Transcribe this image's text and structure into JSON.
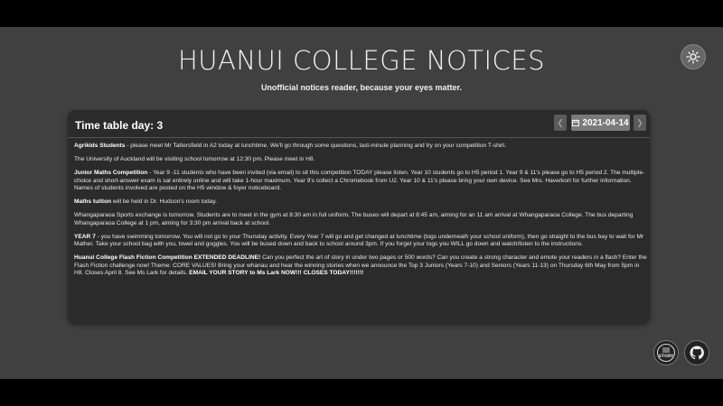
{
  "header": {
    "title": "HUANUI COLLEGE NOTICES",
    "subtitle": "Unofficial notices reader, because your eyes matter."
  },
  "toolbar": {
    "theme_icon": "sun-icon"
  },
  "card": {
    "day_label": "Time table day: 3",
    "date": "2021-04-14",
    "prev_icon": "chevron-left-icon",
    "next_icon": "chevron-right-icon",
    "calendar_icon": "calendar-icon"
  },
  "notices": [
    {
      "title": "Agrikids Students",
      "sep": " - ",
      "body": "please meet Mr Tattersfield in A2 today at lunchtime. We'll go through some questions, last-minute planning and try on your competition T-shirt."
    },
    {
      "title": "",
      "sep": "",
      "body": "The University of Auckland will be visiting school tomorrow at 12:30 pm. Please meet in H8."
    },
    {
      "title": "Junior Maths Competition",
      "sep": " - ",
      "body": "Year 9 -11 students who have been invited (via email) to sit this competition TODAY please listen. Year 10 students go to H5 period 1. Year 9 & 11's please go to H5  period 2.  The multiple-choice and short-answer exam is sat entirely online and will take 1-hour maximum. Year 9's collect a Chromebook from U2. Year 10 & 11's please bring your own device. See Mrs. Haverkort for further information. Names of students involved are posted on the H5 window & foyer noticeboard."
    },
    {
      "title": "Maths tuition",
      "sep": " ",
      "body": "will be held in Dr. Hudson's room today."
    },
    {
      "title": "",
      "sep": "",
      "body": "Whangaparaoa Sports exchange is tomorrow. Students are to meet in the gym at 8:30 am in full uniform.  The buses will depart at 8:45 am, aiming for an 11 am arrival at Whangaparaoa College.  The bus departing Whangaparaoa College at 1 pm, aiming for 3:30 pm arrival back at school."
    },
    {
      "title": "YEAR 7",
      "sep": " - ",
      "body": "you have swimming tomorrow. You will not go to your Thursday activity. Every Year 7 will go and get changed at lunchtime (togs underneath your school uniform), then go straight to the bus bay to wait for Mr Mather. Take your school bag with you, towel and goggles. You will be bused down and back to school around 3pm. If you forget your togs you WILL go down and watch/listen to the instructions."
    },
    {
      "title": "Huanui College Flash Fiction Competition EXTENDED DEADLINE!",
      "sep": " ",
      "body": "Can you perfect the art of story in under two pages or 500 words? Can you create a strong character and emote your readers in a flash? Enter the Flash Fiction challenge now! Theme: CORE VALUES! Bring your whanau and hear the winning stories when we announce the Top 3 Juniors (Years 7-10) and Seniors (Years 11-13) on Thursday 6th May from 5pm in H8.  Closes April 8. See Ms Lark for details. ",
      "tail": "EMAIL YOUR STORY to Ms Lark NOW!!!  CLOSES TODAY!!!!!!!"
    }
  ],
  "footer": {
    "story_button": "STORY",
    "story_icon": "story-badge-icon",
    "github_icon": "github-icon"
  }
}
